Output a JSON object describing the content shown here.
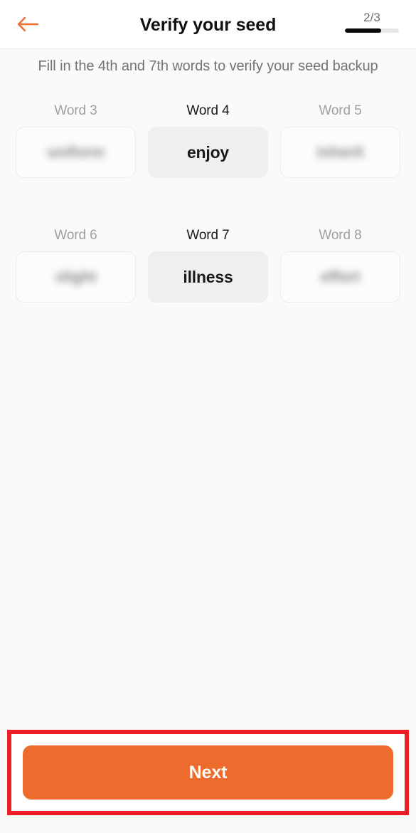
{
  "header": {
    "title": "Verify your seed",
    "back_icon": "arrow-left-icon",
    "back_icon_color": "#ef6c33",
    "progress_label": "2/3",
    "progress_current": 2,
    "progress_total": 3,
    "progress_percent": 67,
    "progress_fill_color": "#0b0b0b",
    "progress_track_color": "#e8e8e8"
  },
  "subtitle": "Fill in the 4th and 7th words to verify your seed backup",
  "words": {
    "rows": [
      {
        "cells": [
          {
            "label": "Word 3",
            "value": "uniform",
            "blurred": true,
            "active": false
          },
          {
            "label": "Word 4",
            "value": "enjoy",
            "blurred": false,
            "active": true
          },
          {
            "label": "Word 5",
            "value": "inherit",
            "blurred": true,
            "active": false
          }
        ]
      },
      {
        "cells": [
          {
            "label": "Word 6",
            "value": "slight",
            "blurred": true,
            "active": false
          },
          {
            "label": "Word 7",
            "value": "illness",
            "blurred": false,
            "active": true
          },
          {
            "label": "Word 8",
            "value": "effort",
            "blurred": true,
            "active": false
          }
        ]
      }
    ]
  },
  "cta": {
    "label": "Next",
    "button_color": "#ed6b2d",
    "highlight_color": "#ec1d24"
  },
  "theme": {
    "background": "#fafafa",
    "header_background": "#ffffff",
    "accent": "#ef6c33",
    "muted_text": "#a0a0a0",
    "body_text": "#1a1a1a"
  }
}
